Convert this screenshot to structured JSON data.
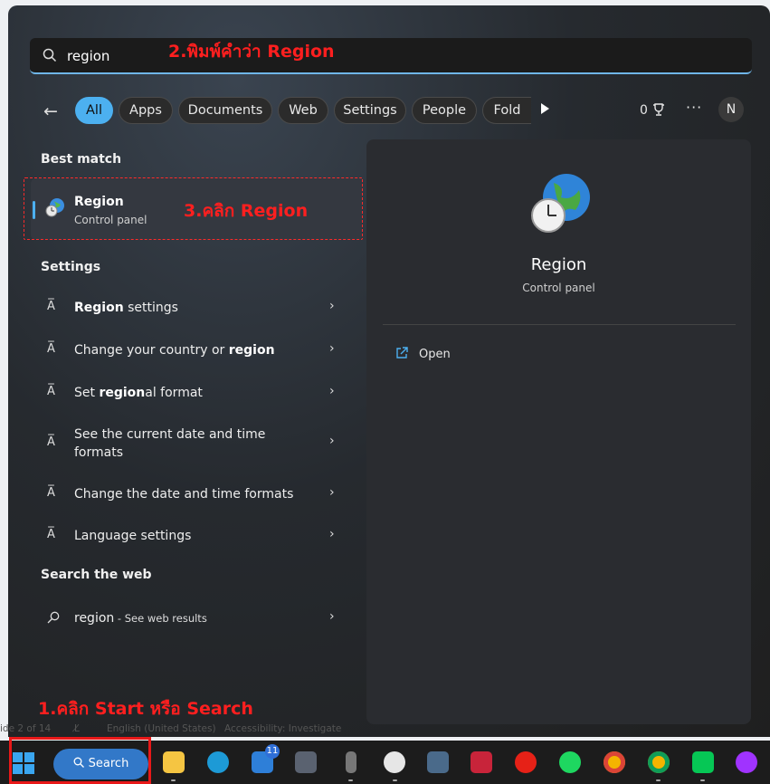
{
  "search": {
    "value": "region",
    "annotation": "2.พิมพ์คำว่า Region"
  },
  "filters": {
    "back_icon": "arrow-left-icon",
    "chips": [
      "All",
      "Apps",
      "Documents",
      "Web",
      "Settings",
      "People",
      "Fold"
    ],
    "rewards_count": "0",
    "more": "···",
    "avatar_initial": "N"
  },
  "best_match": {
    "header": "Best match",
    "item": {
      "title": "Region",
      "subtitle": "Control panel"
    },
    "annotation": "3.คลิก Region"
  },
  "settings": {
    "header": "Settings",
    "items": [
      {
        "pre": "",
        "bold": "Region",
        "post": " settings"
      },
      {
        "pre": "Change your country or ",
        "bold": "region",
        "post": ""
      },
      {
        "pre": "Set ",
        "bold": "region",
        "post": "al format"
      },
      {
        "pre": "See the current date and time formats",
        "bold": "",
        "post": ""
      },
      {
        "pre": "Change the date and time formats",
        "bold": "",
        "post": ""
      },
      {
        "pre": "Language settings",
        "bold": "",
        "post": ""
      }
    ]
  },
  "web": {
    "header": "Search the web",
    "query": "region",
    "suffix": " - See web results"
  },
  "preview": {
    "title": "Region",
    "subtitle": "Control panel",
    "open_label": "Open"
  },
  "start_annotation": "1.คลิก Start หรือ Search",
  "statusbar": {
    "slide": "ide 2 of 14",
    "language": "English (United States)",
    "accessibility": "Accessibility: Investigate"
  },
  "taskbar": {
    "search_label": "Search",
    "mail_badge": "11"
  },
  "colors": {
    "accent": "#4cb0f0",
    "annotation": "#ff1f1f"
  }
}
